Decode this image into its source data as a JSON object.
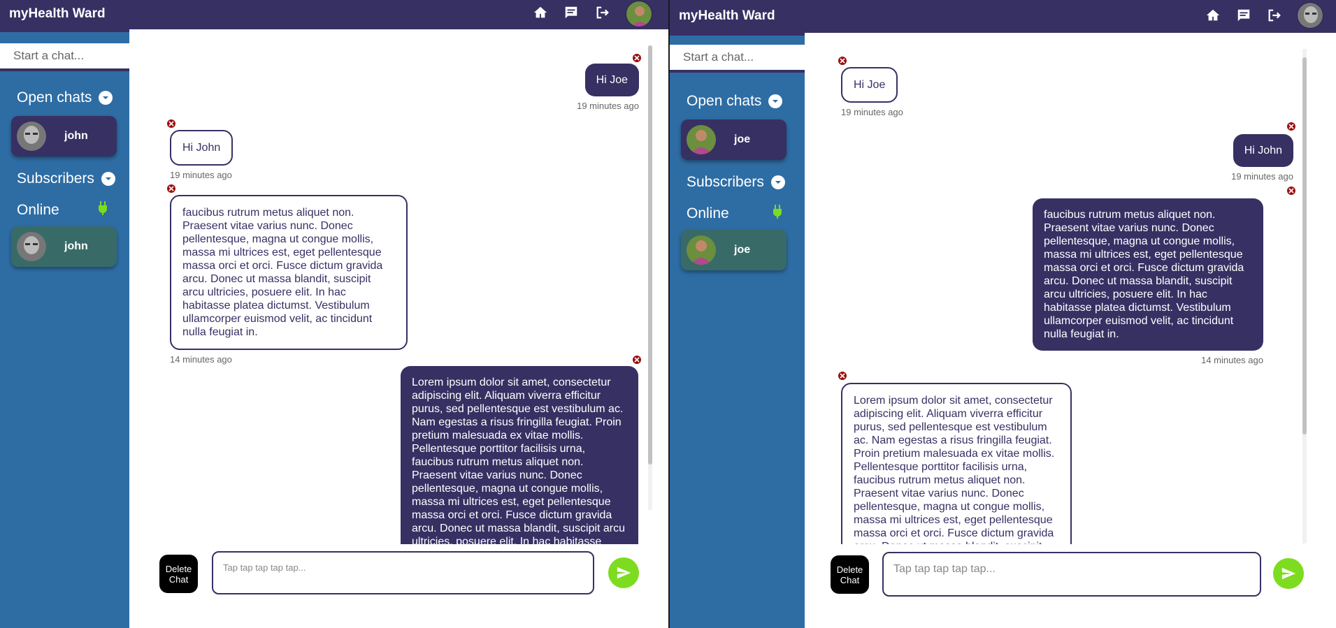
{
  "left": {
    "brand": "myHealth Ward",
    "search_placeholder": "Start a chat...",
    "open_chats_label": "Open chats",
    "open_chat_name": "john",
    "subscribers_label": "Subscribers",
    "online_label": "Online",
    "online_name": "john",
    "messages": [
      {
        "text": "Hi Joe",
        "time": "19 minutes ago",
        "side": "sent"
      },
      {
        "text": "Hi John",
        "time": "19 minutes ago",
        "side": "recv"
      },
      {
        "text": "faucibus rutrum metus aliquet non. Praesent vitae varius nunc. Donec pellentesque, magna ut congue mollis, massa mi ultrices est, eget pellentesque massa orci et orci. Fusce dictum gravida arcu. Donec ut massa blandit, suscipit arcu ultricies, posuere elit. In hac habitasse platea dictumst. Vestibulum ullamcorper euismod velit, ac tincidunt nulla feugiat in.",
        "time": "14 minutes ago",
        "side": "recv"
      },
      {
        "text": "Lorem ipsum dolor sit amet, consectetur adipiscing elit. Aliquam viverra efficitur purus, sed pellentesque est vestibulum ac. Nam egestas a risus fringilla feugiat. Proin pretium malesuada ex vitae mollis. Pellentesque porttitor facilisis urna, faucibus rutrum metus aliquet non. Praesent vitae varius nunc. Donec pellentesque, magna ut congue mollis, massa mi ultrices est, eget pellentesque massa orci et orci. Fusce dictum gravida arcu. Donec ut massa blandit, suscipit arcu ultricies, posuere elit. In hac habitasse",
        "time": "",
        "side": "sent"
      }
    ],
    "delete_label": "Delete\nChat",
    "input_placeholder": "Tap tap tap tap tap..."
  },
  "right": {
    "brand": "myHealth Ward",
    "search_placeholder": "Start a chat...",
    "open_chats_label": "Open chats",
    "open_chat_name": "joe",
    "subscribers_label": "Subscribers",
    "online_label": "Online",
    "online_name": "joe",
    "messages": [
      {
        "text": "Hi Joe",
        "time": "19 minutes ago",
        "side": "recv"
      },
      {
        "text": "Hi John",
        "time": "19 minutes ago",
        "side": "sent"
      },
      {
        "text": "faucibus rutrum metus aliquet non. Praesent vitae varius nunc. Donec pellentesque, magna ut congue mollis, massa mi ultrices est, eget pellentesque massa orci et orci. Fusce dictum gravida arcu. Donec ut massa blandit, suscipit arcu ultricies, posuere elit. In hac habitasse platea dictumst. Vestibulum ullamcorper euismod velit, ac tincidunt nulla feugiat in.",
        "time": "14 minutes ago",
        "side": "sent"
      },
      {
        "text": "Lorem ipsum dolor sit amet, consectetur adipiscing elit. Aliquam viverra efficitur purus, sed pellentesque est vestibulum ac. Nam egestas a risus fringilla feugiat. Proin pretium malesuada ex vitae mollis. Pellentesque porttitor facilisis urna, faucibus rutrum metus aliquet non. Praesent vitae varius nunc. Donec pellentesque, magna ut congue mollis, massa mi ultrices est, eget pellentesque massa orci et orci. Fusce dictum gravida arcu. Donec ut massa blandit, suscipit arcu",
        "time": "",
        "side": "recv"
      }
    ],
    "delete_label": "Delete\nChat",
    "input_placeholder": "Tap tap tap tap tap..."
  },
  "icons": {
    "home": "home-icon",
    "chat": "chat-icon",
    "logout": "logout-icon",
    "online_status": "plug-icon",
    "send": "send-icon",
    "delete_message": "close-icon",
    "expand": "chevron-down-icon"
  },
  "colors": {
    "primary": "#373063",
    "sidebar": "#2e6da4",
    "online_card": "#386b68",
    "send": "#7ddc1f",
    "online_indicator": "#7ddc1f",
    "delete_x": "#9b0f10"
  }
}
